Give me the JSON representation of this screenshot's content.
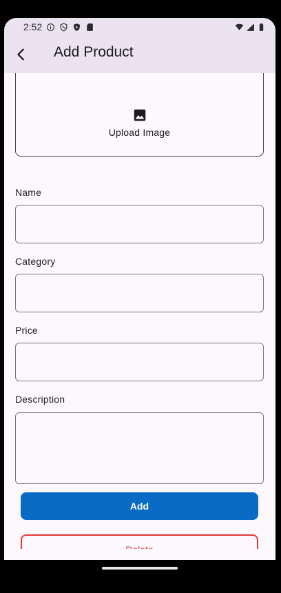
{
  "status_bar": {
    "time": "2:52",
    "left_icons": [
      "info-icon",
      "shield-icon",
      "play-protect-icon",
      "sd-card-icon"
    ],
    "right_icons": [
      "wifi-icon",
      "signal-icon",
      "battery-icon"
    ]
  },
  "app_bar": {
    "title": "Add Product",
    "back_icon": "back-arrow-icon"
  },
  "upload": {
    "label": "Upload Image",
    "icon": "image-icon"
  },
  "form": {
    "name": {
      "label": "Name",
      "value": ""
    },
    "category": {
      "label": "Category",
      "value": ""
    },
    "price": {
      "label": "Price",
      "value": ""
    },
    "description": {
      "label": "Description",
      "value": ""
    }
  },
  "buttons": {
    "add_label": "Add",
    "delete_label": "Delete"
  },
  "colors": {
    "primary": "#0a6bc6",
    "danger": "#e53935",
    "app_bar_bg": "#ebe3f0",
    "surface": "#fdf7fe"
  }
}
